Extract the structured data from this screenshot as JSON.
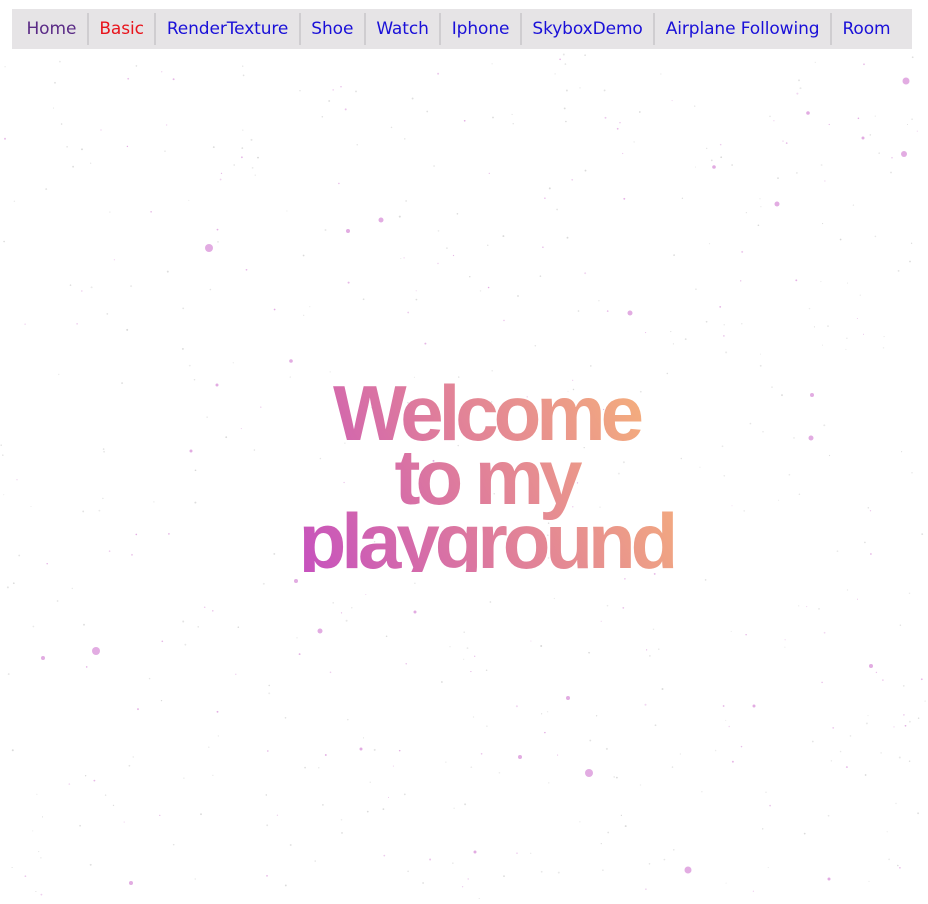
{
  "nav": {
    "items": [
      {
        "label": "Home",
        "state": "visited"
      },
      {
        "label": "Basic",
        "state": "active"
      },
      {
        "label": "RenderTexture",
        "state": "link"
      },
      {
        "label": "Shoe",
        "state": "link"
      },
      {
        "label": "Watch",
        "state": "link"
      },
      {
        "label": "Iphone",
        "state": "link"
      },
      {
        "label": "SkyboxDemo",
        "state": "link"
      },
      {
        "label": "Airplane Following",
        "state": "link"
      },
      {
        "label": "Room",
        "state": "link"
      }
    ]
  },
  "hero": {
    "line1": "Welcome",
    "line2": "to my",
    "line3": "playground"
  },
  "colors": {
    "nav_background": "#e6e4e6",
    "link": "#1a10d8",
    "visited_link": "#5a2a86",
    "active_link": "#e8141c",
    "gradient_start": "#c54fc0",
    "gradient_mid": "#e07f9a",
    "gradient_end": "#f6b27a",
    "particle": "#d890d8"
  }
}
